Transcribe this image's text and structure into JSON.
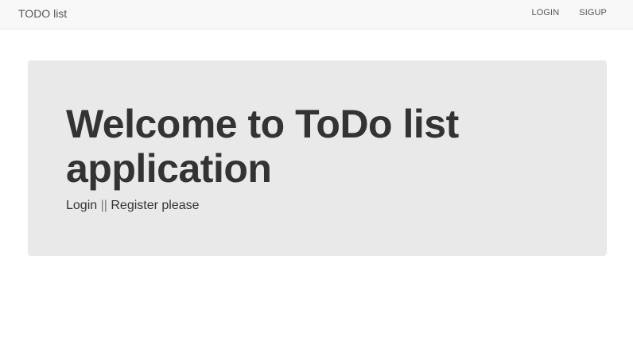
{
  "navbar": {
    "brand": "TODO list",
    "links": [
      {
        "label": "LOGIN"
      },
      {
        "label": "SIGUP"
      }
    ]
  },
  "jumbotron": {
    "title": "Welcome to ToDo list application",
    "login_link": "Login",
    "separator": "||",
    "register_link": "Register please"
  },
  "colors": {
    "navbar_bg": "#f8f8f8",
    "jumbotron_bg": "#e9e9e9",
    "text": "#333333"
  }
}
